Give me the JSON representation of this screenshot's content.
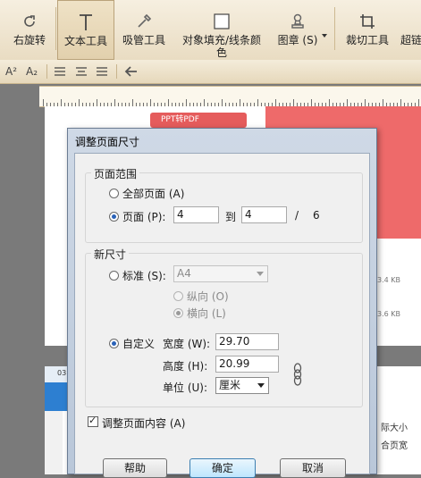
{
  "toolbar": {
    "rotate_right": "右旋转",
    "text_tool": "文本工具",
    "pipette_tool": "吸管工具",
    "object_fill": "对象填充/线条颜色",
    "stamp": "图章 (S)",
    "crop_tool": "裁切工具",
    "super": "超链"
  },
  "format_row": {
    "superscript": "A²",
    "subscript": "A₂"
  },
  "background": {
    "pdf_tab": "PPT转PDF",
    "size_1": "3.4 KB",
    "size_2": "3.6 KB",
    "tab_text": "03",
    "right_text_1": "际大小",
    "right_text_2": "合页宽"
  },
  "dialog": {
    "title": "调整页面尺寸",
    "page_range": {
      "group_label": "页面范围",
      "all_pages": "全部页面 (A)",
      "pages": "页面 (P):",
      "from": "4",
      "to_label": "到",
      "to": "4",
      "separator": "/",
      "total": "6"
    },
    "new_size": {
      "group_label": "新尺寸",
      "standard": "标准 (S):",
      "standard_value": "A4",
      "portrait": "纵向 (O)",
      "landscape": "横向 (L)",
      "custom": "自定义",
      "width_label": "宽度 (W):",
      "width": "29.70",
      "height_label": "高度 (H):",
      "height": "20.99",
      "unit_label": "单位 (U):",
      "unit": "厘米"
    },
    "adjust_content": "调整页面内容 (A)",
    "help": "帮助",
    "ok": "确定",
    "cancel": "取消"
  }
}
